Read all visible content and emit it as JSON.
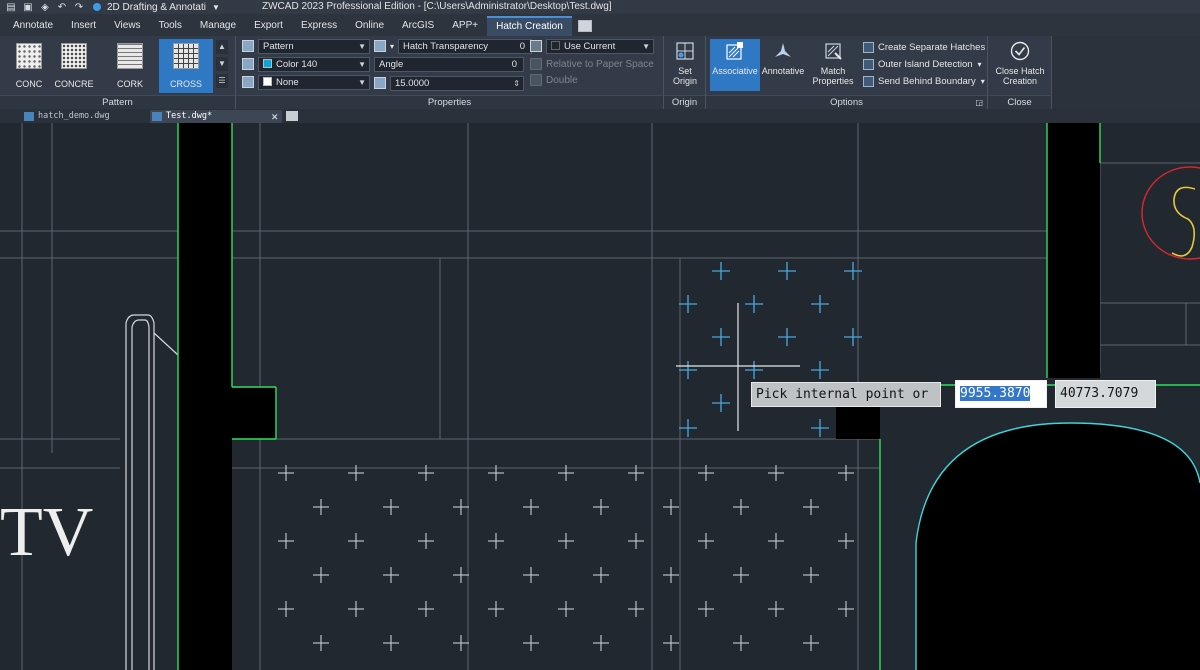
{
  "titlebar": {
    "workspace": "2D Drafting & Annotati",
    "app_title": "ZWCAD 2023 Professional Edition - [C:\\Users\\Administrator\\Desktop\\Test.dwg]"
  },
  "tabs": [
    "Annotate",
    "Insert",
    "Views",
    "Tools",
    "Manage",
    "Export",
    "Express",
    "Online",
    "ArcGIS",
    "APP+",
    "Hatch Creation"
  ],
  "pattern": {
    "title": "Pattern",
    "swatches": [
      "CONC",
      "CONCRE",
      "CORK",
      "CROSS"
    ],
    "selected": "CROSS"
  },
  "properties": {
    "title": "Properties",
    "type": "Pattern",
    "color": "Color 140",
    "color_hex": "#00a9e0",
    "background": "None",
    "transparency_label": "Hatch Transparency",
    "transparency_value": "0",
    "angle_label": "Angle",
    "angle_value": "0",
    "scale_value": "15.0000",
    "layer": "Use Current",
    "relative": "Relative to Paper Space",
    "double": "Double"
  },
  "origin": {
    "title": "Origin",
    "set_origin": "Set Origin"
  },
  "options": {
    "title": "Options",
    "associative": "Associative",
    "annotative": "Annotative",
    "match_properties": "Match Properties",
    "create_separate": "Create Separate Hatches",
    "outer_island": "Outer Island Detection",
    "send_behind": "Send Behind Boundary"
  },
  "close": {
    "title": "Close",
    "close_hatch": "Close Hatch Creation"
  },
  "files": [
    {
      "name": "hatch_demo.dwg",
      "active": false
    },
    {
      "name": "Test.dwg*",
      "active": true
    }
  ],
  "canvas": {
    "prompt": "Pick internal point or",
    "coord_x": "9955.3870",
    "coord_y": "40773.7079",
    "tv_text": "TV",
    "hatch_color": "#4aa8e0",
    "boundary_color": "#2ee05c",
    "arc_color": "#3fd4d6"
  }
}
